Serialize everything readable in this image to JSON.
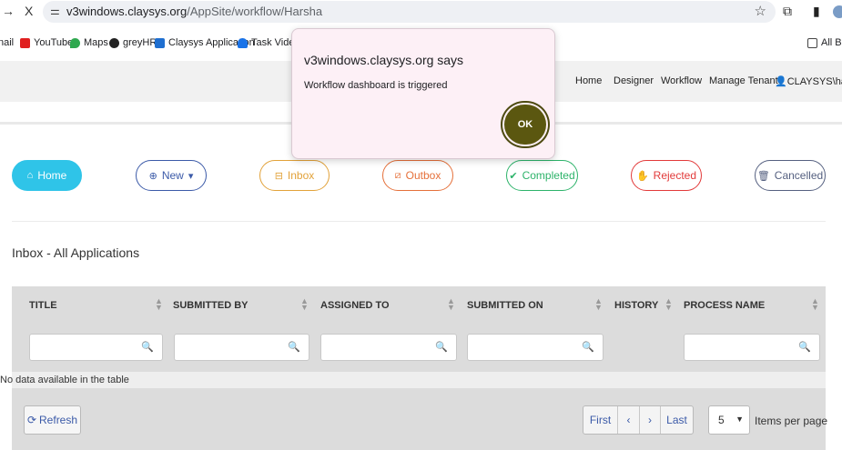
{
  "browser": {
    "back_icon": "→",
    "close_icon": "X",
    "url_host": "v3windows.claysys.org",
    "url_path": "/AppSite/workflow/Harsha"
  },
  "bookmarks": [
    {
      "label": "nail",
      "color": ""
    },
    {
      "label": "YouTube",
      "color": "#e02020"
    },
    {
      "label": "Maps",
      "color": "#2fa84f"
    },
    {
      "label": "greyHR",
      "color": "#222222"
    },
    {
      "label": "Claysys Application",
      "color": "#1f6fd0"
    },
    {
      "label": "Task Video",
      "color": "#1a73e8"
    },
    {
      "label": "All Boo",
      "color": ""
    }
  ],
  "nav": {
    "home": "Home",
    "designer": "Designer",
    "workflow": "Workflow",
    "manage_tenant": "Manage Tenant",
    "user": "CLAYSYS\\harsha."
  },
  "status_buttons": {
    "home": "Home",
    "new": "New",
    "inbox": "Inbox",
    "outbox": "Outbox",
    "completed": "Completed",
    "rejected": "Rejected",
    "cancelled": "Cancelled"
  },
  "section_title": "Inbox - All Applications",
  "table": {
    "columns": [
      "TITLE",
      "SUBMITTED BY",
      "ASSIGNED TO",
      "SUBMITTED ON",
      "HISTORY",
      "PROCESS NAME"
    ],
    "empty_message": "No data available in the table"
  },
  "footer": {
    "refresh": "Refresh",
    "pager": {
      "first": "First",
      "prev": "‹",
      "next": "›",
      "last": "Last"
    },
    "page_size": "5",
    "items_per_page": "Items per page"
  },
  "dialog": {
    "title": "v3windows.claysys.org says",
    "message": "Workflow dashboard is triggered",
    "ok": "OK"
  },
  "colors": {
    "accent": "#2fc4e8",
    "ok_button": "#5b5710",
    "link": "#3b5aa8"
  }
}
